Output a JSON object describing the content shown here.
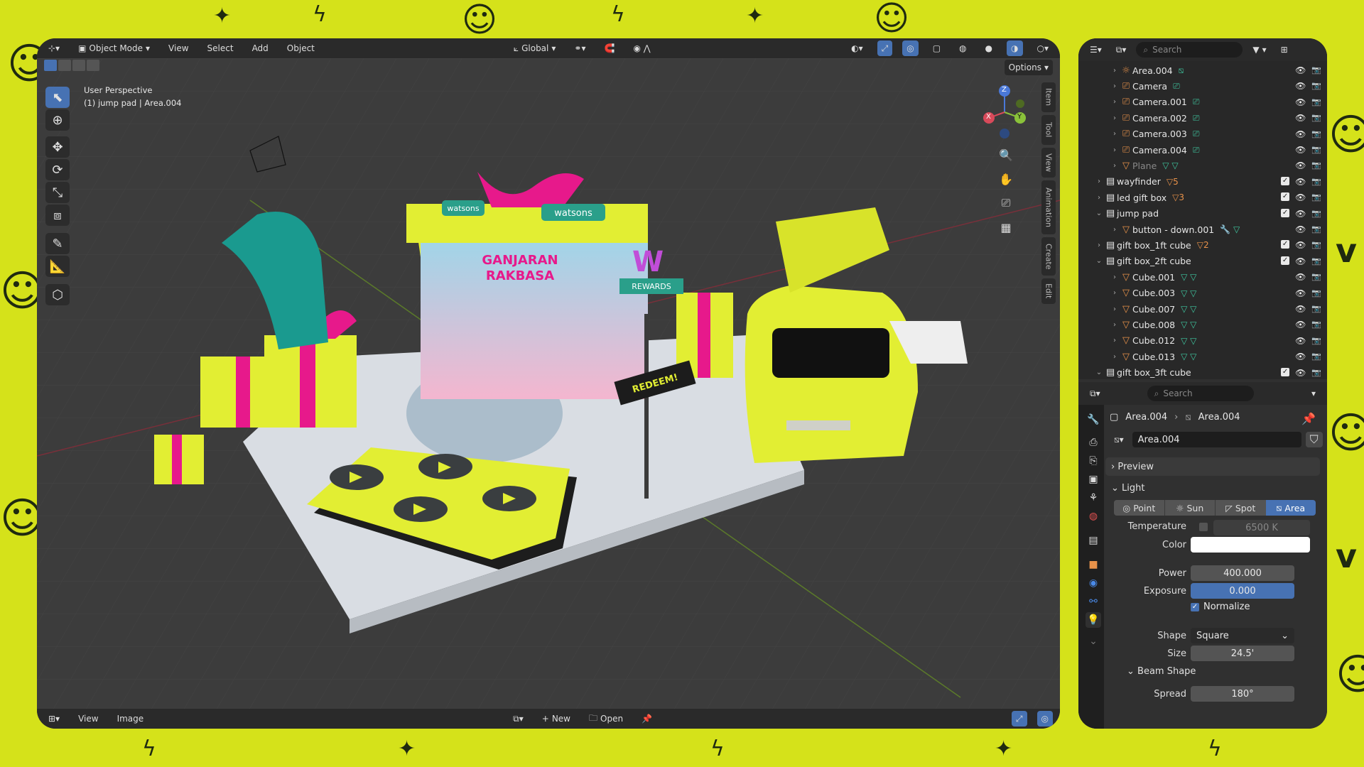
{
  "viewport": {
    "header": {
      "mode": "Object Mode",
      "menus": [
        "View",
        "Select",
        "Add",
        "Object"
      ],
      "orientation": "Global",
      "options": "Options"
    },
    "overlay": {
      "perspective": "User Perspective",
      "context": "(1) jump pad | Area.004"
    },
    "side_tabs": [
      "Item",
      "Tool",
      "View",
      "Animation",
      "Create",
      "Edit"
    ],
    "gizmo": {
      "x": "X",
      "y": "Y",
      "z": "Z"
    },
    "footer": {
      "menus": [
        "View",
        "Image"
      ],
      "new_label": "New",
      "open_label": "Open"
    },
    "scene_text": {
      "brand": "watsons",
      "banner1": "GANJARAN",
      "banner2": "RAKBASA",
      "sign_top": "W",
      "rewards": "REWARDS",
      "redeem": "REDEEM!"
    }
  },
  "outliner": {
    "search_placeholder": "Search",
    "rows": [
      {
        "name": "Area.004",
        "indent": 2,
        "icon": "light",
        "extra": "light-data",
        "type": "obj"
      },
      {
        "name": "Camera",
        "indent": 2,
        "icon": "camera",
        "extra": "camera-data",
        "type": "obj"
      },
      {
        "name": "Camera.001",
        "indent": 2,
        "icon": "camera",
        "extra": "camera-data",
        "type": "obj"
      },
      {
        "name": "Camera.002",
        "indent": 2,
        "icon": "camera",
        "extra": "camera-data",
        "type": "obj"
      },
      {
        "name": "Camera.003",
        "indent": 2,
        "icon": "camera",
        "extra": "camera-data",
        "type": "obj"
      },
      {
        "name": "Camera.004",
        "indent": 2,
        "icon": "camera",
        "extra": "camera-data",
        "type": "obj"
      },
      {
        "name": "Plane",
        "indent": 2,
        "icon": "mesh",
        "extra": "mesh-data",
        "type": "dim"
      },
      {
        "name": "wayfinder",
        "indent": 1,
        "icon": "collection",
        "extra": "5",
        "type": "coll"
      },
      {
        "name": "led gift box",
        "indent": 1,
        "icon": "collection",
        "extra": "3",
        "type": "coll"
      },
      {
        "name": "jump pad",
        "indent": 1,
        "icon": "collection",
        "extra": "",
        "type": "coll"
      },
      {
        "name": "button - down.001",
        "indent": 2,
        "icon": "mesh",
        "extra": "mod",
        "type": "obj"
      },
      {
        "name": "gift box_1ft cube",
        "indent": 1,
        "icon": "collection",
        "extra": "2",
        "type": "coll"
      },
      {
        "name": "gift box_2ft cube",
        "indent": 1,
        "icon": "collection",
        "extra": "",
        "type": "coll"
      },
      {
        "name": "Cube.001",
        "indent": 2,
        "icon": "mesh",
        "extra": "mesh-data",
        "type": "obj"
      },
      {
        "name": "Cube.003",
        "indent": 2,
        "icon": "mesh",
        "extra": "mesh-data",
        "type": "obj"
      },
      {
        "name": "Cube.007",
        "indent": 2,
        "icon": "mesh",
        "extra": "mesh-data",
        "type": "obj"
      },
      {
        "name": "Cube.008",
        "indent": 2,
        "icon": "mesh",
        "extra": "mesh-data",
        "type": "obj"
      },
      {
        "name": "Cube.012",
        "indent": 2,
        "icon": "mesh",
        "extra": "mesh-data",
        "type": "obj"
      },
      {
        "name": "Cube.013",
        "indent": 2,
        "icon": "mesh",
        "extra": "mesh-data",
        "type": "obj"
      },
      {
        "name": "gift box_3ft cube",
        "indent": 1,
        "icon": "collection",
        "extra": "",
        "type": "coll"
      }
    ]
  },
  "properties": {
    "search_placeholder": "Search",
    "breadcrumb": {
      "object": "Area.004",
      "data": "Area.004"
    },
    "datablock": "Area.004",
    "preview_label": "Preview",
    "light_label": "Light",
    "light_types": [
      "Point",
      "Sun",
      "Spot",
      "Area"
    ],
    "active_type": "Area",
    "temperature_label": "Temperature",
    "temperature_value": "6500 K",
    "color_label": "Color",
    "color_value": "#ffffff",
    "power_label": "Power",
    "power_value": "400.000",
    "exposure_label": "Exposure",
    "exposure_value": "0.000",
    "normalize_label": "Normalize",
    "shape_label": "Shape",
    "shape_value": "Square",
    "size_label": "Size",
    "size_value": "24.5'",
    "beam_label": "Beam Shape",
    "spread_label": "Spread",
    "spread_value": "180°"
  },
  "colors": {
    "accent": "#4772b3",
    "bg": "#d5e21a",
    "panel": "#303030"
  }
}
